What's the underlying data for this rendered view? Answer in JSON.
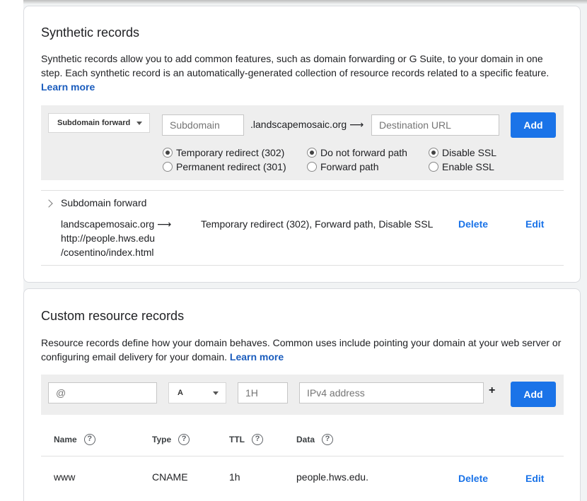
{
  "synthetic": {
    "title": "Synthetic records",
    "desc": "Synthetic records allow you to add common features, such as domain forwarding or G Suite, to your domain in one step. Each synthetic record is an automatically-generated collection of resource records related to a specific feature.",
    "learn_more": "Learn more",
    "form": {
      "type_select": "Subdomain forward",
      "subdomain_placeholder": "Subdomain",
      "domain_suffix": ".landscapemosaic.org ⟶",
      "destination_placeholder": "Destination URL",
      "add_label": "Add",
      "radio_redirect_temp": "Temporary redirect (302)",
      "radio_redirect_perm": "Permanent redirect (301)",
      "radio_path_no": "Do not forward path",
      "radio_path_yes": "Forward path",
      "radio_ssl_disable": "Disable SSL",
      "radio_ssl_enable": "Enable SSL"
    },
    "record": {
      "group_label": "Subdomain forward",
      "source_line1": "landscapemosaic.org ⟶",
      "source_line2": "http://people.hws.edu",
      "source_line3": "/cosentino/index.html",
      "summary": "Temporary redirect (302), Forward path, Disable SSL",
      "delete_label": "Delete",
      "edit_label": "Edit"
    }
  },
  "custom": {
    "title": "Custom resource records",
    "desc": "Resource records define how your domain behaves. Common uses include pointing your domain at your web server or configuring email delivery for your domain.",
    "learn_more": "Learn more",
    "form": {
      "name_placeholder": "@",
      "type_select": "A",
      "ttl_placeholder": "1H",
      "data_placeholder": "IPv4 address",
      "plus": "+",
      "add_label": "Add"
    },
    "table": {
      "headers": [
        "Name",
        "Type",
        "TTL",
        "Data"
      ],
      "help_glyph": "?",
      "rows": [
        {
          "name": "www",
          "type": "CNAME",
          "ttl": "1h",
          "data": "people.hws.edu.",
          "delete_label": "Delete",
          "edit_label": "Edit"
        }
      ]
    }
  }
}
